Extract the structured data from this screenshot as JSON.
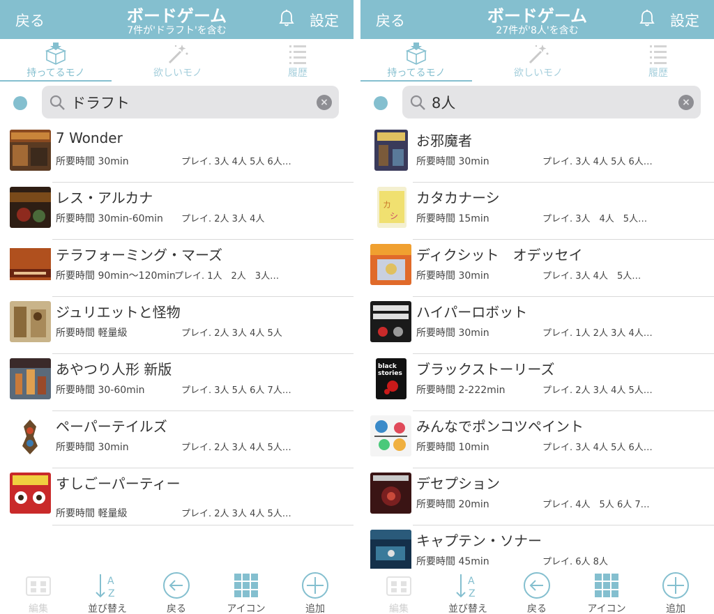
{
  "colors": {
    "header": "#84bfcf",
    "accent": "#84bfcf"
  },
  "screens": [
    {
      "header": {
        "back": "戻る",
        "title": "ボードゲーム",
        "subtitle": "7件が'ドラフト'を含む",
        "settings": "設定"
      },
      "tabs": [
        "持ってるモノ",
        "欲しいモノ",
        "履歴"
      ],
      "search": {
        "value": "ドラフト"
      },
      "items": [
        {
          "title": "7 Wonder",
          "time": "所要時間 30min",
          "players": "プレイ. 3人 4人 5人 6人…",
          "thumb": "7-wonders-box"
        },
        {
          "title": "レス・アルカナ",
          "time": "所要時間 30min-60min",
          "players": "プレイ. 2人 3人 4人",
          "thumb": "res-arcana-box"
        },
        {
          "title": "テラフォーミング・マーズ",
          "time": "所要時間 90min〜120min",
          "players": "プレイ. 1人　2人　3人…",
          "thumb": "terraforming-mars-box"
        },
        {
          "title": "ジュリエットと怪物",
          "time": "所要時間 軽量級",
          "players": "プレイ. 2人 3人 4人 5人",
          "thumb": "juliet-box"
        },
        {
          "title": "あやつり人形 新版",
          "time": "所要時間 30-60min",
          "players": "プレイ. 3人 5人 6人 7人…",
          "thumb": "citadels-box"
        },
        {
          "title": "ペーパーテイルズ",
          "time": "所要時間 30min",
          "players": "プレイ. 2人 3人 4人 5人…",
          "thumb": "paper-tales-box"
        },
        {
          "title": "すしごーパーティー",
          "time": "所要時間 軽量級",
          "players": "プレイ. 2人 3人 4人 5人…",
          "thumb": "sushi-go-party-box"
        }
      ],
      "toolbar": [
        "編集",
        "並び替え",
        "戻る",
        "アイコン",
        "追加"
      ]
    },
    {
      "header": {
        "back": "戻る",
        "title": "ボードゲーム",
        "subtitle": "27件が'8人'を含む",
        "settings": "設定"
      },
      "tabs": [
        "持ってるモノ",
        "欲しいモノ",
        "履歴"
      ],
      "search": {
        "value": "8人"
      },
      "items": [
        {
          "title": "お邪魔者",
          "time": "所要時間 30min",
          "players": "プレイ. 3人 4人 5人 6人…",
          "thumb": "saboteur-box"
        },
        {
          "title": "カタカナーシ",
          "time": "所要時間 15min",
          "players": "プレイ. 3人　4人　5人…",
          "thumb": "katakanashi-box"
        },
        {
          "title": "ディクシット　オデッセイ",
          "time": "所要時間 30min",
          "players": "プレイ. 3人 4人　5人…",
          "thumb": "dixit-odyssey-box"
        },
        {
          "title": "ハイパーロボット",
          "time": "所要時間 30min",
          "players": "プレイ. 1人 2人 3人 4人…",
          "thumb": "ricochet-robots-box"
        },
        {
          "title": "ブラックストーリーズ",
          "time": "所要時間 2-222min",
          "players": "プレイ. 2人 3人 4人 5人…",
          "thumb": "black-stories-box"
        },
        {
          "title": "みんなでポンコツペイント",
          "time": "所要時間 10min",
          "players": "プレイ. 3人 4人 5人 6人…",
          "thumb": "ponkotsu-paint-box"
        },
        {
          "title": "デセプション",
          "time": "所要時間 20min",
          "players": "プレイ. 4人　5人 6人 7…",
          "thumb": "deception-box"
        },
        {
          "title": "キャプテン・ソナー",
          "time": "所要時間 45min",
          "players": "プレイ. 6人 8人",
          "thumb": "captain-sonar-box"
        }
      ],
      "toolbar": [
        "編集",
        "並び替え",
        "戻る",
        "アイコン",
        "追加"
      ]
    }
  ]
}
